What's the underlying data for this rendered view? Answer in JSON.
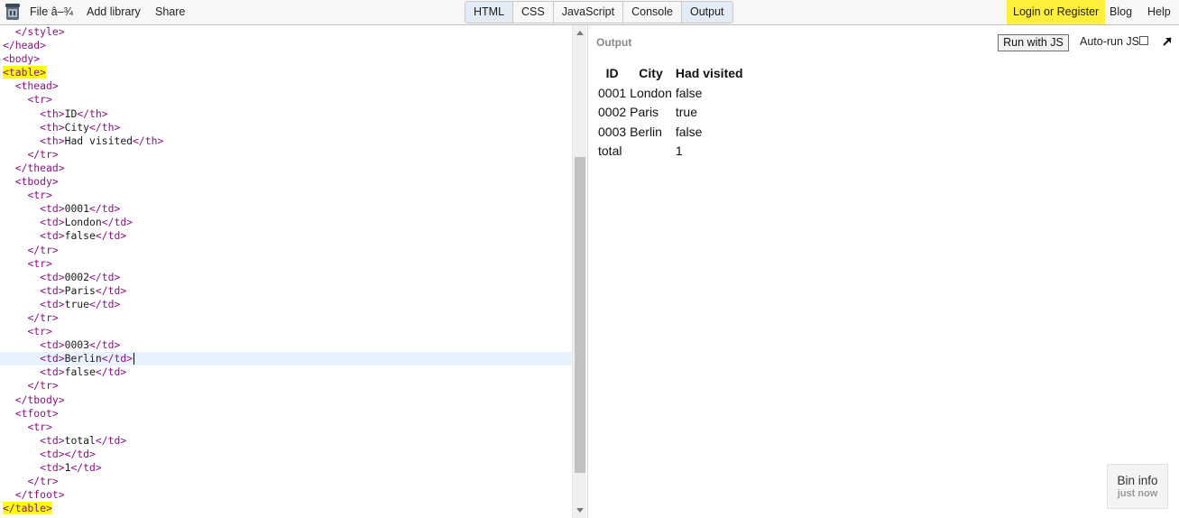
{
  "menu": {
    "file": "File â–¾",
    "add_library": "Add library",
    "share": "Share"
  },
  "tabs": [
    "HTML",
    "CSS",
    "JavaScript",
    "Console",
    "Output"
  ],
  "active_tabs": [
    "HTML",
    "Output"
  ],
  "right_menu": {
    "login": "Login or Register",
    "blog": "Blog",
    "help": "Help"
  },
  "colors": {
    "highlight": "#ffff00",
    "login_bg": "#ffef3a",
    "tag": "#881280",
    "active_tab": "#e3ecf5"
  },
  "editor": {
    "active_line": 24,
    "lines": [
      "  </style>",
      "</head>",
      "<body>",
      "<table>",
      "  <thead>",
      "    <tr>",
      "      <th>ID</th>",
      "      <th>City</th>",
      "      <th>Had visited</th>",
      "    </tr>",
      "  </thead>",
      "  <tbody>",
      "    <tr>",
      "      <td>0001</td>",
      "      <td>London</td>",
      "      <td>false</td>",
      "    </tr>",
      "    <tr>",
      "      <td>0002</td>",
      "      <td>Paris</td>",
      "      <td>true</td>",
      "    </tr>",
      "    <tr>",
      "      <td>0003</td>",
      "      <td>Berlin</td>",
      "      <td>false</td>",
      "    </tr>",
      "  </tbody>",
      "  <tfoot>",
      "    <tr>",
      "      <td>total</td>",
      "      <td></td>",
      "      <td>1</td>",
      "    </tr>",
      "  </tfoot>",
      "</table>"
    ],
    "highlighted_lines": [
      3,
      35
    ]
  },
  "output": {
    "label": "Output",
    "run_button": "Run with JS",
    "autorun_label": "Auto-run JS",
    "table": {
      "headers": [
        "ID",
        "City",
        "Had visited"
      ],
      "rows": [
        [
          "0001",
          "London",
          "false"
        ],
        [
          "0002",
          "Paris",
          "true"
        ],
        [
          "0003",
          "Berlin",
          "false"
        ]
      ],
      "footer": [
        "total",
        "",
        "1"
      ]
    }
  },
  "bin_info": {
    "title": "Bin info",
    "subtitle": "just now"
  }
}
